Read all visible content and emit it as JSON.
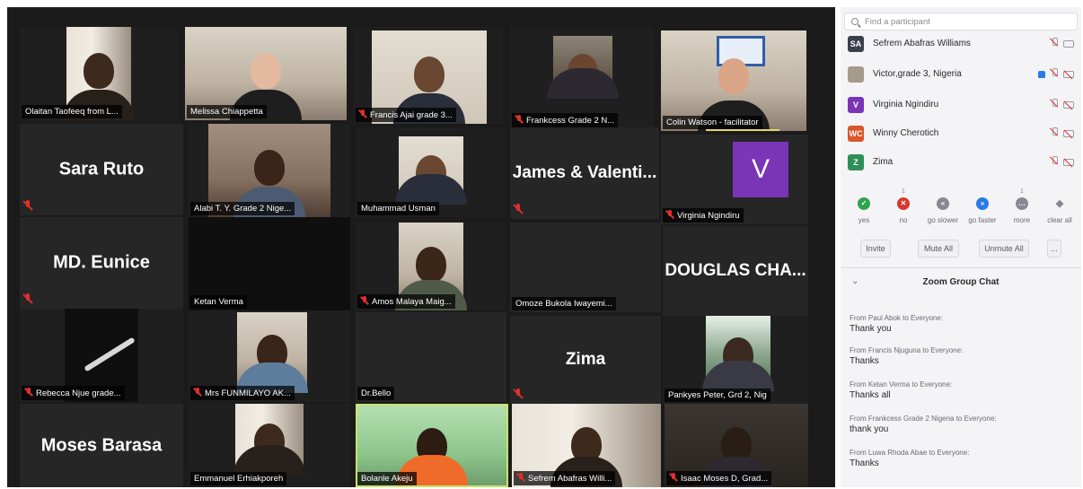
{
  "gallery": {
    "tiles": [
      {
        "label": "Olaitan Taofeeq from L..."
      },
      {
        "label": "Melissa Chiappetta"
      },
      {
        "label": "Francis Ajai grade 3..."
      },
      {
        "label": "Frankcess Grade 2 N..."
      },
      {
        "label": "Colin Watson - facilitator"
      },
      {
        "name": "Sara Ruto"
      },
      {
        "label": "Alabi T. Y. Grade 2 Nige..."
      },
      {
        "label": "Muhammad Usman"
      },
      {
        "name": "James & Valenti..."
      },
      {
        "label": "Virginia Ngindiru",
        "avatar": "V"
      },
      {
        "name": "MD. Eunice"
      },
      {
        "label": "Ketan Verma"
      },
      {
        "label": "Amos Malaya Maig..."
      },
      {
        "label": "Omoze Bukola Iwayemi..."
      },
      {
        "name": "DOUGLAS CHA..."
      },
      {
        "label": "Rebecca Njue grade..."
      },
      {
        "label": "Mrs FUNMILAYO AK..."
      },
      {
        "label": "Dr.Bello"
      },
      {
        "name": "Zima"
      },
      {
        "label": "Pankyes Peter, Grd 2, Nig"
      },
      {
        "name": "Moses Barasa"
      },
      {
        "label": "Emmanuel Erhiakporeh"
      },
      {
        "label": "Bolanle Akeju"
      },
      {
        "label": "Sefrem Abafras Willi..."
      },
      {
        "label": "Isaac Moses D, Grad..."
      }
    ]
  },
  "panel": {
    "search_placeholder": "Find a participant",
    "participants": [
      {
        "initials": "SA",
        "name": "Sefrem Abafras Williams",
        "color": "#3a3f4a"
      },
      {
        "initials": "",
        "name": "Victor,grade 3, Nigeria",
        "color": "#a59a8c"
      },
      {
        "initials": "V",
        "name": "Virginia Ngindiru",
        "color": "#7a34b6"
      },
      {
        "initials": "WC",
        "name": "Winny Cherotich",
        "color": "#d9572a"
      },
      {
        "initials": "Z",
        "name": "Zima",
        "color": "#2f8f58"
      }
    ],
    "reactions": [
      {
        "label": "yes",
        "glyph": "✓",
        "color": "#2fa44f",
        "count": ""
      },
      {
        "label": "no",
        "glyph": "✕",
        "color": "#d9372c",
        "count": "1"
      },
      {
        "label": "go slower",
        "glyph": "«",
        "color": "#8a8793",
        "count": ""
      },
      {
        "label": "go faster",
        "glyph": "»",
        "color": "#2a7be4",
        "count": ""
      },
      {
        "label": "more",
        "glyph": "…",
        "color": "#8a8793",
        "count": "1"
      },
      {
        "label": "clear all",
        "glyph": "◆",
        "color": "#8a8793",
        "count": ""
      }
    ],
    "buttons": {
      "invite": "Invite",
      "mute_all": "Mute All",
      "unmute_all": "Unmute All",
      "more": "..."
    },
    "chat": {
      "title": "Zoom Group Chat",
      "messages": [
        {
          "from": "From Paul Abok to Everyone:",
          "text": "Thank you"
        },
        {
          "from": "From Francis Njuguna to Everyone:",
          "text": "Thanks"
        },
        {
          "from": "From Ketan Verma to Everyone:",
          "text": "Thanks all"
        },
        {
          "from": "From Frankcess Grade 2 Nigeria to Everyone:",
          "text": "thank you"
        },
        {
          "from": "From Luwa Rhoda Abae to Everyone:",
          "text": "Thanks"
        }
      ]
    }
  }
}
